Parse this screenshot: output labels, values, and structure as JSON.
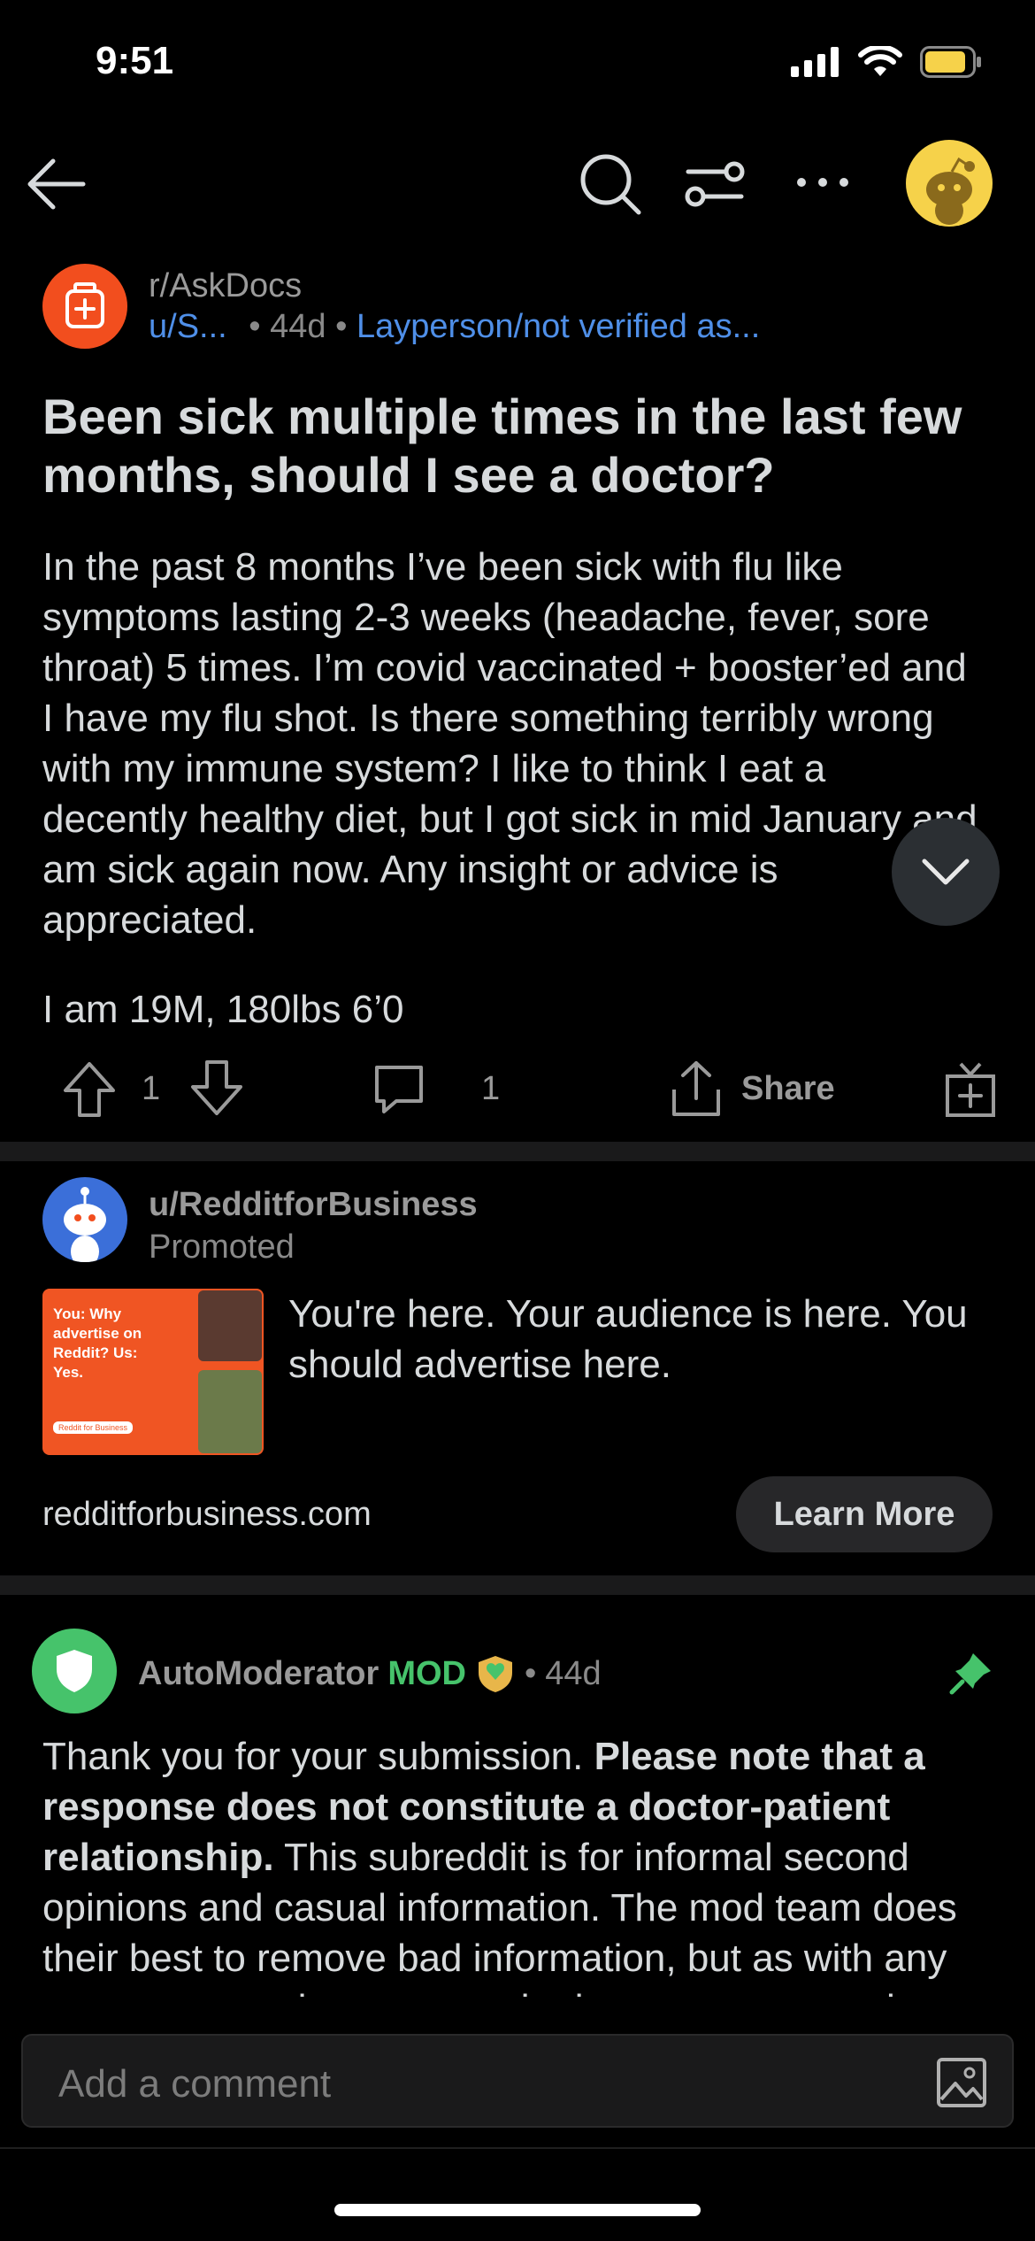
{
  "status_bar": {
    "time": "9:51"
  },
  "post": {
    "subreddit": "r/AskDocs",
    "author": "u/S...",
    "separator": "•",
    "age": "44d",
    "flair": "Layperson/not verified as...",
    "title": "Been sick multiple times in the last few months, should I see a doctor?",
    "body": "In the past 8 months I’ve been sick with flu like symptoms lasting 2-3 weeks (headache, fever, sore throat) 5 times. I’m covid vaccinated + booster’ed and I have my flu shot. Is there something terribly wrong with my immune system? I like to think I eat a decently healthy diet, but I got sick in mid January and am sick again now. Any insight or advice is appreciated.",
    "body_line2": "I am 19M, 180lbs 6’0",
    "votes": "1",
    "comments": "1",
    "share_label": "Share"
  },
  "ad": {
    "user": "u/RedditforBusiness",
    "promoted_label": "Promoted",
    "thumb_text": "You: Why advertise on Reddit? Us: Yes.",
    "thumb_brand": "Reddit for Business",
    "text": "You're here. Your audience is here. You should advertise here.",
    "domain": "redditforbusiness.com",
    "cta": "Learn More"
  },
  "comment": {
    "author": "AutoModerator",
    "mod_badge": "MOD",
    "separator": "•",
    "age": "44d",
    "body_part1": "Thank you for your submission. ",
    "body_bold": "Please note that a response does not constitute a doctor-patient relationship.",
    "body_part2": " This subreddit is for informal second opinions and casual information. The mod team does their best to remove bad information, but as with any user-generated content on the internet, use your best judgment."
  },
  "composer": {
    "placeholder": "Add a comment"
  },
  "colors": {
    "background": "#000000",
    "link_blue": "#4f8fe8",
    "subreddit_orange": "#f24e1e",
    "mod_green": "#46c36b",
    "avatar_yellow": "#f6d24a"
  }
}
